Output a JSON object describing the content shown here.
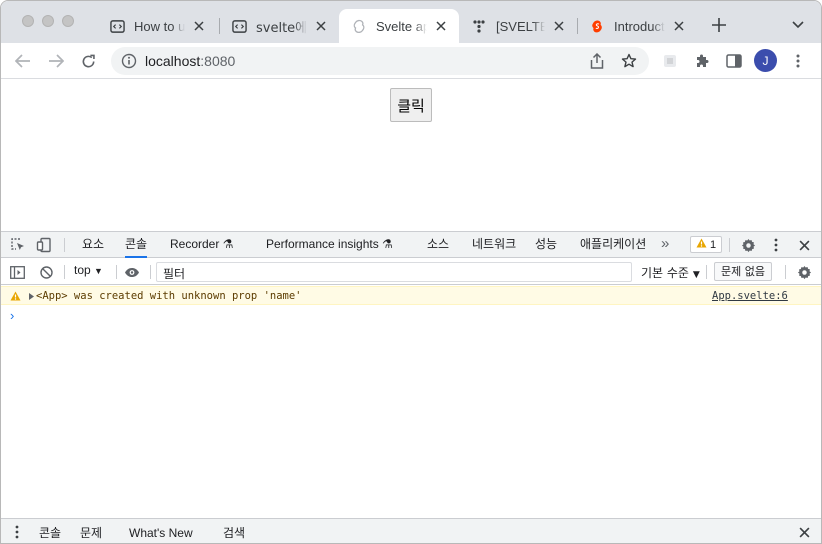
{
  "browser": {
    "tabs": [
      {
        "title": "How to use",
        "favicon": "code-icon"
      },
      {
        "title": "svelte에서",
        "favicon": "code-icon"
      },
      {
        "title": "Svelte app",
        "favicon": "svelte-icon",
        "active": true
      },
      {
        "title": "[SVELTE] ",
        "favicon": "velog-icon"
      },
      {
        "title": "Introduction",
        "favicon": "svelte-icon"
      }
    ],
    "url_host": "localhost",
    "url_port": ":8080",
    "profile_initial": "J"
  },
  "page": {
    "button_label": "클릭"
  },
  "devtools": {
    "tabs": [
      "요소",
      "콘솔",
      "Recorder",
      "Performance insights",
      "소스",
      "네트워크",
      "성능",
      "애플리케이션"
    ],
    "selected_tab": "콘솔",
    "issues_count": "1",
    "console_toolbar": {
      "context": "top",
      "filter_value": "필터",
      "levels": "기본 수준",
      "no_issues": "문제 없음"
    },
    "messages": [
      {
        "level": "warning",
        "text": "<App> was created with unknown prop 'name'",
        "source": "App.svelte:6"
      }
    ],
    "drawer_tabs": [
      "콘솔",
      "문제",
      "What's New",
      "검색"
    ],
    "drawer_selected": "콘솔"
  },
  "colors": {
    "accent": "#1a73e8",
    "warning_bg": "#fffbe5",
    "warning_icon": "#e8a600",
    "tabstrip": "#dee1e6"
  }
}
